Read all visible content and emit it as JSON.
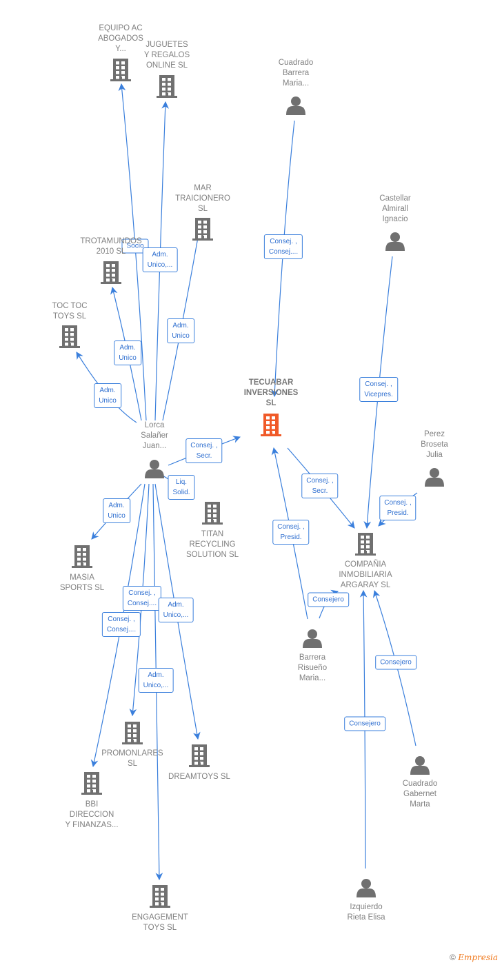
{
  "colors": {
    "edge": "#3a7fdc",
    "node": "#707070",
    "focus": "#f05a28"
  },
  "nodes": [
    {
      "id": "equipo",
      "type": "company",
      "lines": [
        "EQUIPO AC",
        "ABOGADOS",
        "Y..."
      ]
    },
    {
      "id": "juguetes",
      "type": "company",
      "lines": [
        "JUGUETES",
        "Y REGALOS",
        "ONLINE  SL"
      ]
    },
    {
      "id": "mar",
      "type": "company",
      "lines": [
        "MAR",
        "TRAICIONERO",
        "SL"
      ]
    },
    {
      "id": "trotamundos",
      "type": "company",
      "lines": [
        "TROTAMUNDOS",
        "2010 SL"
      ]
    },
    {
      "id": "toctoc",
      "type": "company",
      "lines": [
        "TOC TOC",
        "TOYS  SL"
      ]
    },
    {
      "id": "lorca",
      "type": "person",
      "lines": [
        "Lorca",
        "Salañer",
        "Juan..."
      ]
    },
    {
      "id": "tecuabar",
      "type": "focus",
      "lines": [
        "TECUABAR",
        "INVERSIONES",
        "SL"
      ]
    },
    {
      "id": "cuadradoBarrera",
      "type": "person",
      "lines": [
        "Cuadrado",
        "Barrera",
        "Maria..."
      ]
    },
    {
      "id": "castellar",
      "type": "person",
      "lines": [
        "Castellar",
        "Almirall",
        "Ignacio"
      ]
    },
    {
      "id": "perez",
      "type": "person",
      "lines": [
        "Perez",
        "Broseta",
        "Julia"
      ]
    },
    {
      "id": "compania",
      "type": "company",
      "lines": [
        "COMPAÑIA",
        "INMOBILIARIA",
        "ARGARAY  SL"
      ]
    },
    {
      "id": "barrera",
      "type": "person",
      "lines": [
        "Barrera",
        "Risueño",
        "Maria..."
      ]
    },
    {
      "id": "titan",
      "type": "company",
      "lines": [
        "TITAN",
        "RECYCLING",
        "SOLUTION  SL"
      ]
    },
    {
      "id": "masia",
      "type": "company",
      "lines": [
        "MASIA",
        "SPORTS  SL"
      ]
    },
    {
      "id": "promonlares",
      "type": "company",
      "lines": [
        "PROMONLARES",
        "SL"
      ]
    },
    {
      "id": "dreamtoys",
      "type": "company",
      "lines": [
        "DREAMTOYS SL"
      ]
    },
    {
      "id": "bbi",
      "type": "company",
      "lines": [
        "BBI",
        "DIRECCION",
        "Y FINANZAS..."
      ]
    },
    {
      "id": "engagement",
      "type": "company",
      "lines": [
        "ENGAGEMENT",
        "TOYS  SL"
      ]
    },
    {
      "id": "cuadradoGabernet",
      "type": "person",
      "lines": [
        "Cuadrado",
        "Gabernet",
        "Marta"
      ]
    },
    {
      "id": "izquierdo",
      "type": "person",
      "lines": [
        "Izquierdo",
        "Rieta Elisa"
      ]
    }
  ],
  "edges": [
    {
      "from": "lorca",
      "to": "equipo",
      "label": [
        "Socio"
      ]
    },
    {
      "from": "lorca",
      "to": "juguetes",
      "label": [
        "Adm.",
        "Unico,..."
      ]
    },
    {
      "from": "lorca",
      "to": "mar",
      "label": [
        "Adm.",
        "Unico"
      ]
    },
    {
      "from": "lorca",
      "to": "trotamundos",
      "label": [
        "Adm.",
        "Unico"
      ]
    },
    {
      "from": "lorca",
      "to": "toctoc",
      "label": [
        "Adm.",
        "Unico"
      ]
    },
    {
      "from": "lorca",
      "to": "tecuabar",
      "label": [
        "Consej. ,",
        "Secr."
      ]
    },
    {
      "from": "lorca",
      "to": "titan",
      "label": [
        "Liq.",
        "Solid."
      ]
    },
    {
      "from": "lorca",
      "to": "masia",
      "label": [
        "Adm.",
        "Unico"
      ]
    },
    {
      "from": "lorca",
      "to": "bbi",
      "label": [
        "Consej. ,",
        "Consej...."
      ]
    },
    {
      "from": "lorca",
      "to": "promonlares",
      "label": [
        "Consej. ,",
        "Consej...."
      ]
    },
    {
      "from": "lorca",
      "to": "dreamtoys",
      "label": [
        "Adm.",
        "Unico,..."
      ]
    },
    {
      "from": "lorca",
      "to": "engagement",
      "label": [
        "Adm.",
        "Unico,..."
      ]
    },
    {
      "from": "cuadradoBarrera",
      "to": "tecuabar",
      "label": [
        "Consej. ,",
        "Consej...."
      ]
    },
    {
      "from": "castellar",
      "to": "compania",
      "label": [
        "Consej. ,",
        "Vicepres."
      ]
    },
    {
      "from": "tecuabar",
      "to": "compania",
      "label": [
        "Consej. ,",
        "Secr."
      ]
    },
    {
      "from": "perez",
      "to": "compania",
      "label": [
        "Consej. ,",
        "Presid."
      ]
    },
    {
      "from": "barrera",
      "to": "tecuabar",
      "label": [
        "Consej. ,",
        "Presid."
      ]
    },
    {
      "from": "barrera",
      "to": "compania",
      "label": [
        "Consejero"
      ]
    },
    {
      "from": "cuadradoGabernet",
      "to": "compania",
      "label": [
        "Consejero"
      ]
    },
    {
      "from": "izquierdo",
      "to": "compania",
      "label": [
        "Consejero"
      ]
    }
  ],
  "footer": {
    "copyright": "©",
    "brand": "Empresia"
  }
}
